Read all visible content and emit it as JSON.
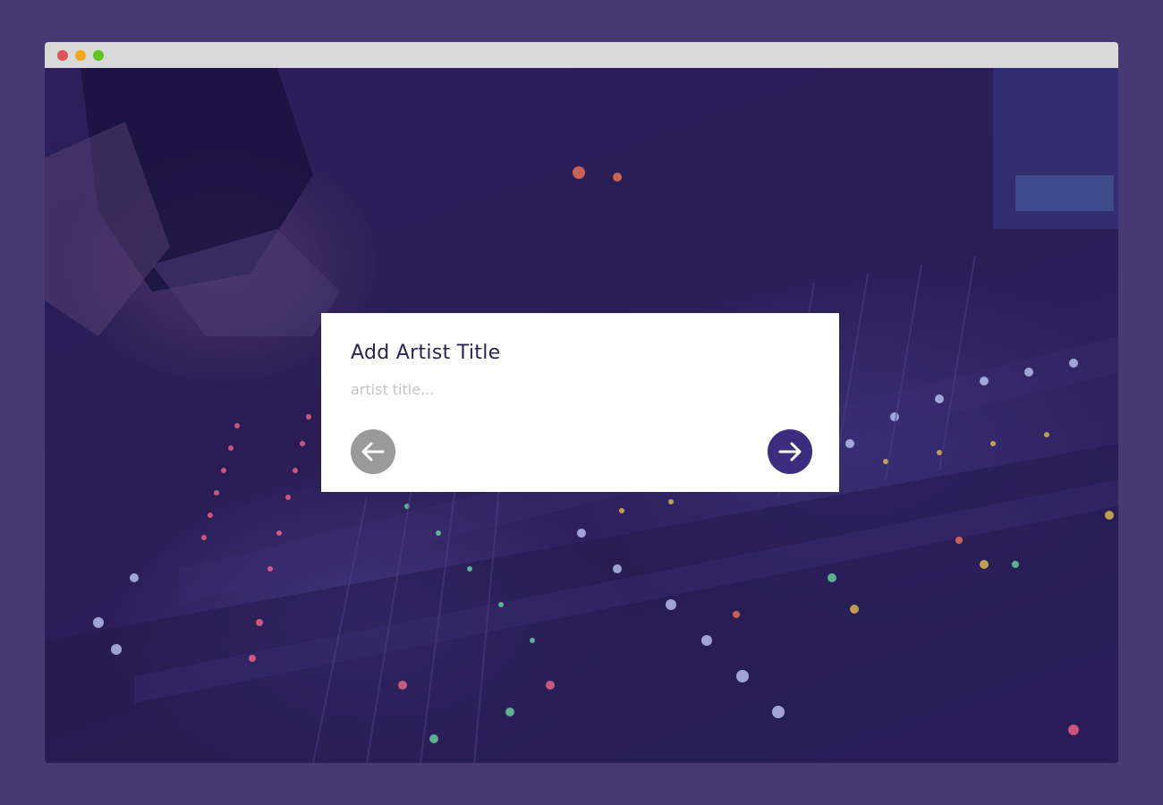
{
  "window": {
    "controls": [
      "close",
      "minimize",
      "maximize"
    ],
    "colors": {
      "close": "#e0505e",
      "minimize": "#f2a61f",
      "maximize": "#62c41f"
    }
  },
  "background": {
    "overlay_color": "#2a1e57"
  },
  "card": {
    "title": "Add Artist Title",
    "input_placeholder": "artist title...",
    "input_value": "",
    "back_icon": "arrow-left-icon",
    "next_icon": "arrow-right-icon",
    "colors": {
      "title": "#2d2156",
      "back_button": "#9a9a9a",
      "next_button": "#3c2d7f"
    }
  }
}
